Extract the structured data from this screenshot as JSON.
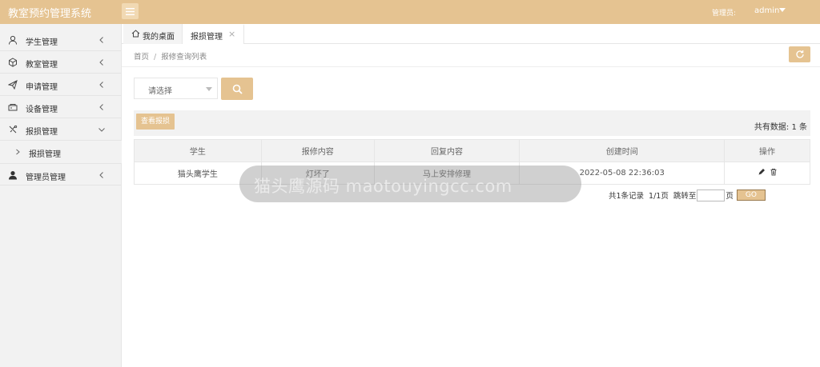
{
  "header": {
    "app_title": "教室预约管理系统",
    "admin_label": "管理员:",
    "admin_name": "admin"
  },
  "sidebar": {
    "items": [
      {
        "label": "学生管理",
        "icon": "user-icon"
      },
      {
        "label": "教室管理",
        "icon": "cube-icon"
      },
      {
        "label": "申请管理",
        "icon": "send-icon"
      },
      {
        "label": "设备管理",
        "icon": "device-icon"
      },
      {
        "label": "报损管理",
        "icon": "tools-icon",
        "expanded": true
      },
      {
        "label": "管理员管理",
        "icon": "person-filled-icon"
      }
    ],
    "sub_item": "报损管理"
  },
  "tabs": {
    "home": "我的桌面",
    "active": "报损管理",
    "close": "×"
  },
  "breadcrumb": {
    "home": "首页",
    "separator": "/",
    "current": "报修查询列表"
  },
  "search": {
    "select_placeholder": "请选择"
  },
  "toolbar": {
    "view_button": "查看报损",
    "total_label": "共有数据:",
    "total_count": "1 条"
  },
  "table": {
    "headers": [
      "学生",
      "报修内容",
      "回复内容",
      "创建时间",
      "操作"
    ],
    "rows": [
      {
        "student": "猫头鹰学生",
        "content": "灯坏了",
        "reply": "马上安排修理",
        "created": "2022-05-08 22:36:03"
      }
    ]
  },
  "pager": {
    "records": "共1条记录",
    "pages": "1/1页",
    "jump_to": "跳转至",
    "page_unit": "页",
    "go": "GO"
  },
  "watermark": "猫头鹰源码 maotouyingcc.com",
  "colors": {
    "accent": "#e5c391",
    "sidebar_bg": "#f2f2f2"
  }
}
